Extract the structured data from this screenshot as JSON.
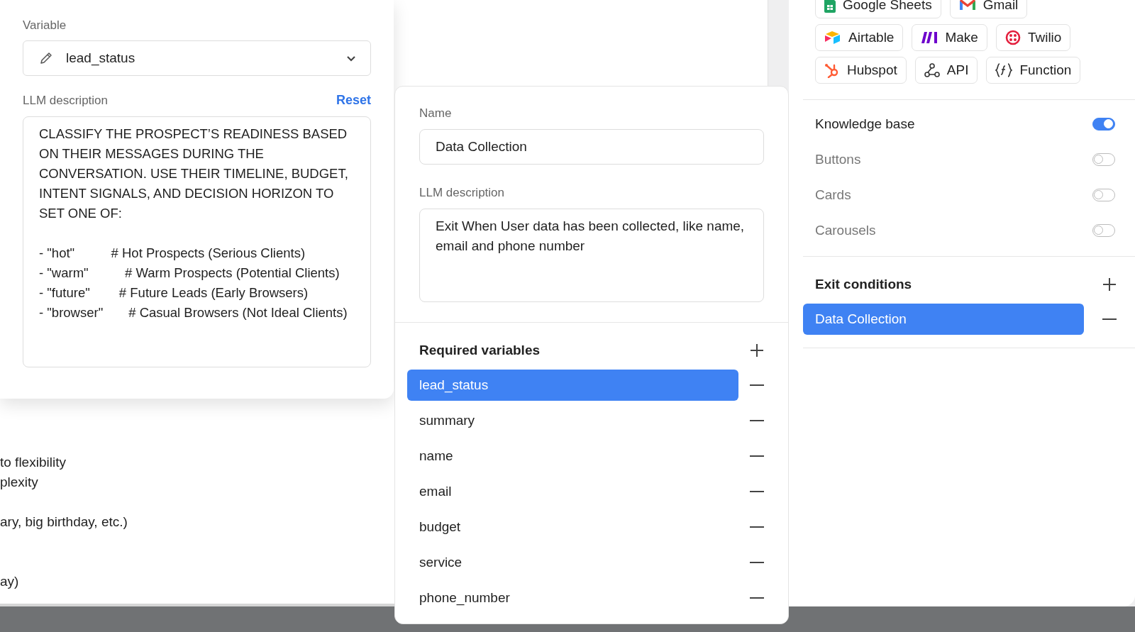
{
  "background_text": [
    "to flexibility",
    "plexity",
    "ary, big birthday, etc.)",
    "ay)"
  ],
  "variable_panel": {
    "variable_label": "Variable",
    "variable_value": "lead_status",
    "llm_label": "LLM description",
    "reset": "Reset",
    "description": "CLASSIFY THE PROSPECT’S READINESS BASED ON THEIR MESSAGES DURING THE CONVERSATION. USE THEIR TIMELINE, BUDGET, INTENT SIGNALS, AND DECISION HORIZON TO SET ONE OF:\n\n- \"hot\"          # Hot Prospects (Serious Clients)\n- \"warm\"          # Warm Prospects (Potential Clients)\n- \"future\"        # Future Leads (Early Browsers)\n- \"browser\"       # Casual Browsers (Not Ideal Clients)"
  },
  "condition_card": {
    "name_label": "Name",
    "name_value": "Data Collection",
    "llm_label": "LLM description",
    "llm_value": "Exit When User data has been collected, like name, email and phone number",
    "required_title": "Required variables",
    "variables": [
      {
        "name": "lead_status",
        "selected": true
      },
      {
        "name": "summary",
        "selected": false
      },
      {
        "name": "name",
        "selected": false
      },
      {
        "name": "email",
        "selected": false
      },
      {
        "name": "budget",
        "selected": false
      },
      {
        "name": "service",
        "selected": false
      },
      {
        "name": "phone_number",
        "selected": false
      }
    ]
  },
  "integrations": [
    [
      {
        "label": "Google Sheets",
        "kind": "sheets"
      },
      {
        "label": "Gmail",
        "kind": "gmail"
      }
    ],
    [
      {
        "label": "Airtable",
        "kind": "airtable"
      },
      {
        "label": "Make",
        "kind": "make"
      },
      {
        "label": "Twilio",
        "kind": "twilio"
      }
    ],
    [
      {
        "label": "Hubspot",
        "kind": "hubspot"
      },
      {
        "label": "API",
        "kind": "api"
      },
      {
        "label": "Function",
        "kind": "function"
      }
    ]
  ],
  "toggles": [
    {
      "label": "Knowledge base",
      "on": true
    },
    {
      "label": "Buttons",
      "on": false
    },
    {
      "label": "Cards",
      "on": false
    },
    {
      "label": "Carousels",
      "on": false
    }
  ],
  "exit_conditions": {
    "title": "Exit conditions",
    "items": [
      {
        "label": "Data Collection",
        "selected": true
      }
    ]
  }
}
